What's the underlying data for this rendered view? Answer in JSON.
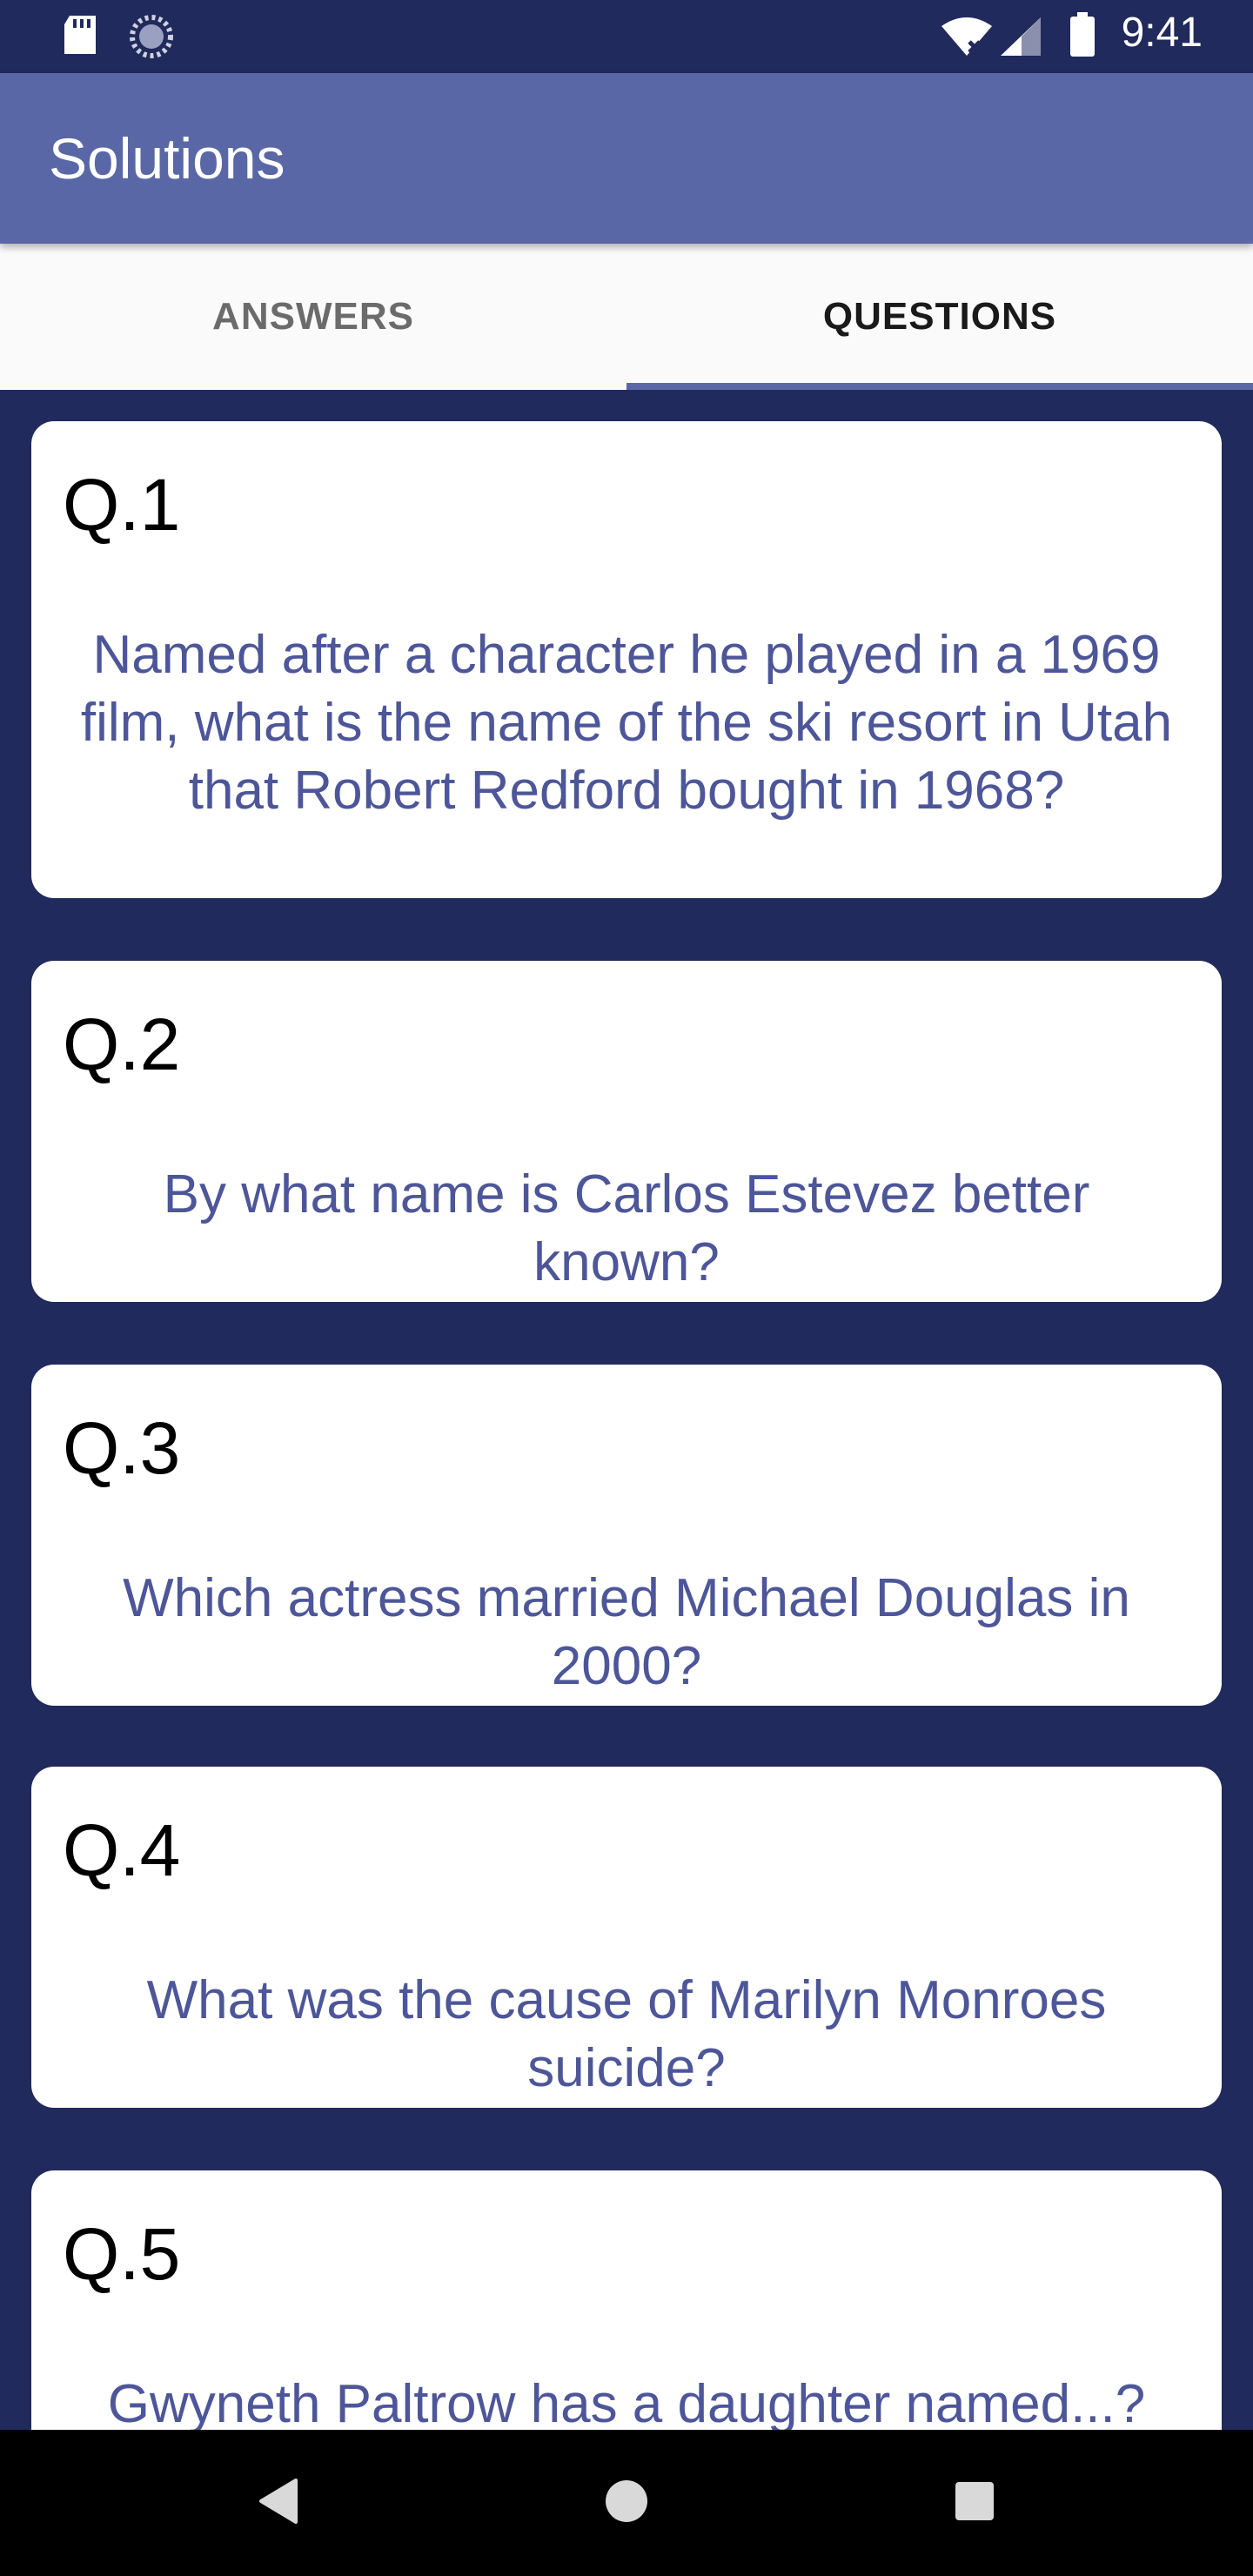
{
  "status_bar": {
    "time": "9:41",
    "icons": [
      "sd-card-icon",
      "sync-icon",
      "wifi-icon",
      "signal-icon",
      "battery-icon"
    ]
  },
  "app_bar": {
    "title": "Solutions"
  },
  "tabs": [
    {
      "label": "ANSWERS",
      "selected": false
    },
    {
      "label": "QUESTIONS",
      "selected": true
    }
  ],
  "questions": [
    {
      "number": "Q.1",
      "text": "Named after a character he played in a 1969 film, what is the name of the ski resort in Utah that Robert Redford bought in 1968?"
    },
    {
      "number": "Q.2",
      "text": "By what name is Carlos Estevez better known?"
    },
    {
      "number": "Q.3",
      "text": "Which actress married Michael Douglas in 2000?"
    },
    {
      "number": "Q.4",
      "text": "What was the cause of Marilyn Monroes suicide?"
    },
    {
      "number": "Q.5",
      "text": "Gwyneth Paltrow has a daughter named...?"
    }
  ],
  "nav_bar": {
    "buttons": [
      "back-icon",
      "home-icon",
      "recents-icon"
    ]
  },
  "colors": {
    "background": "#212a5c",
    "app_bar": "#5a67a6",
    "question_text": "#4d5699",
    "card": "#ffffff"
  }
}
